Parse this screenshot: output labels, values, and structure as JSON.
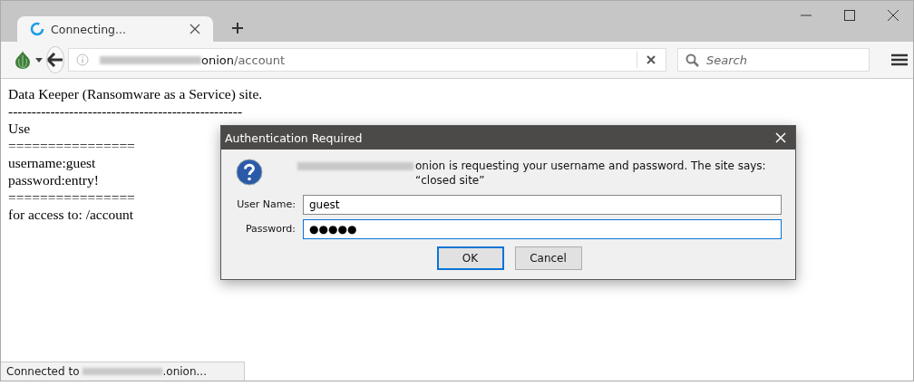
{
  "tabs": [
    {
      "label": "Connecting...",
      "selected": true
    }
  ],
  "toolbar": {
    "url_host": "onion",
    "url_path": "/account",
    "search": {
      "placeholder": "Search"
    }
  },
  "page": {
    "lines": [
      "Data Keeper (Ransomware as a Service) site.",
      "--------------------------------------------------",
      "Use",
      "================",
      "username:guest",
      "password:entry!",
      "================",
      "for access to: /account"
    ]
  },
  "dialog": {
    "title": "Authentication Required",
    "message": "onion is requesting your username and password. The site says: “closed site”",
    "fields": [
      {
        "label": "User Name:",
        "value": "guest",
        "focused": false
      },
      {
        "label": "Password:",
        "value": "●●●●●",
        "focused": true
      }
    ],
    "buttons": [
      {
        "label": "OK",
        "default": true
      },
      {
        "label": "Cancel",
        "default": false
      }
    ]
  },
  "status_bar": {
    "prefix": "Connected to",
    "suffix": ".onion..."
  }
}
